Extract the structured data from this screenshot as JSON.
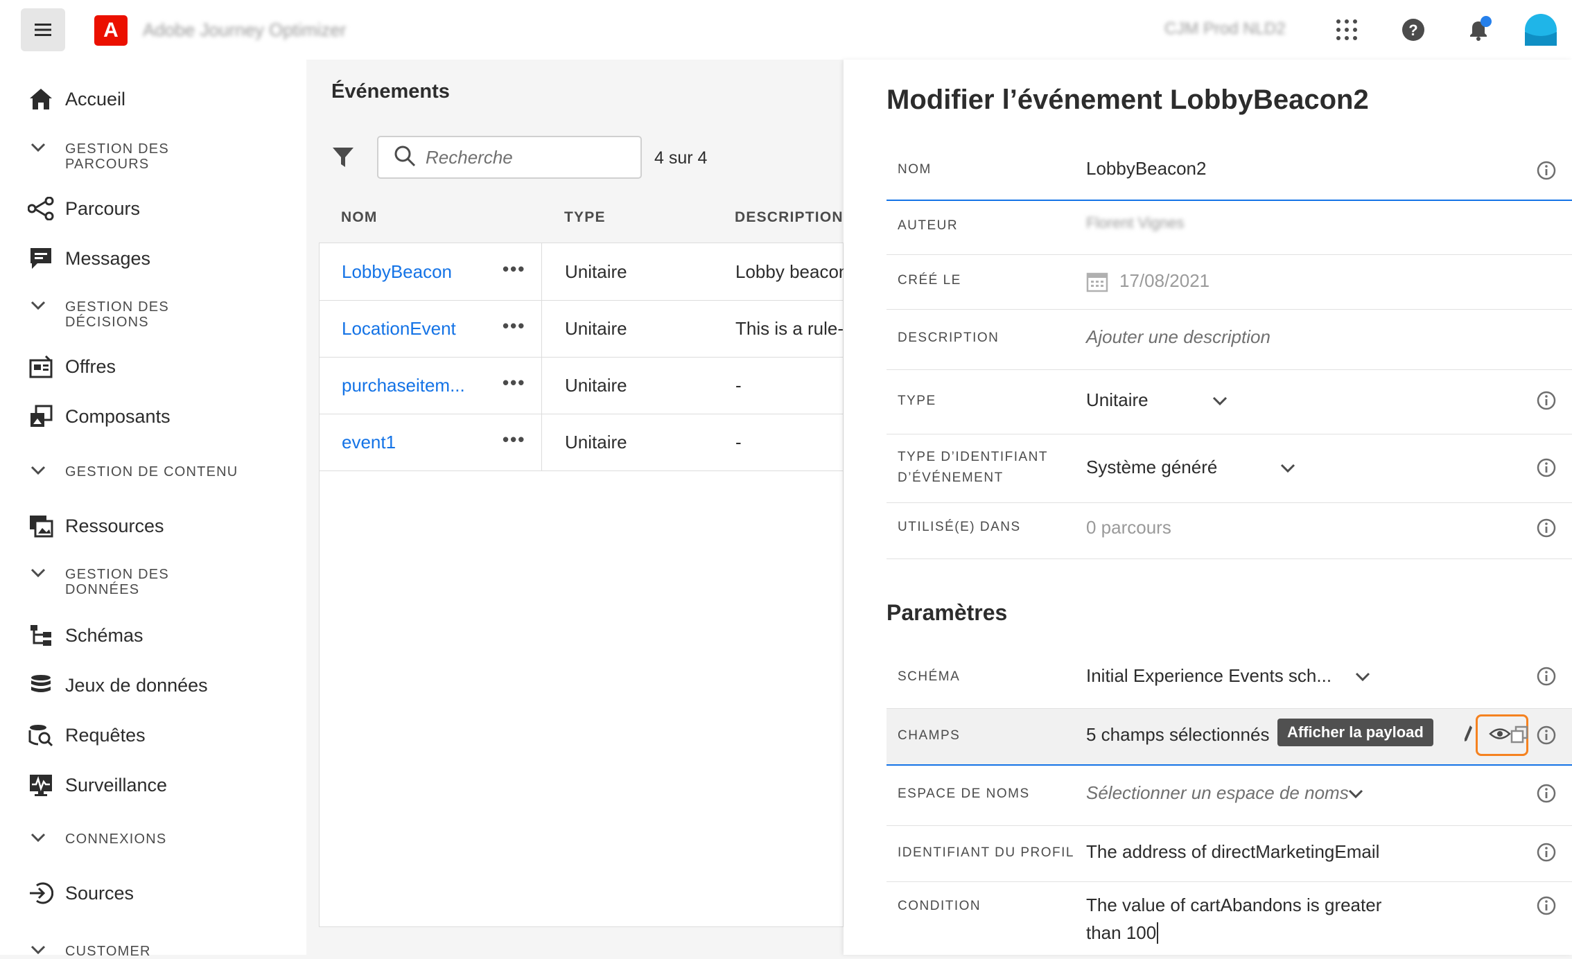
{
  "topbar": {
    "app_name": "Adobe Journey Optimizer",
    "org_name": "CJM Prod NLD2",
    "logo_letter": "A",
    "brand_color": "#eb1000",
    "accent_color": "#1473e6",
    "notification_color": "#2680eb"
  },
  "sidebar": {
    "home": "Accueil",
    "sections": [
      {
        "title": "GESTION DES PARCOURS",
        "items": [
          "Parcours",
          "Messages"
        ]
      },
      {
        "title": "GESTION DES DÉCISIONS",
        "items": [
          "Offres",
          "Composants"
        ]
      },
      {
        "title": "GESTION DE CONTENU",
        "items": [
          "Ressources"
        ]
      },
      {
        "title": "GESTION DES DONNÉES",
        "items": [
          "Schémas",
          "Jeux de données",
          "Requêtes",
          "Surveillance"
        ]
      },
      {
        "title": "CONNEXIONS",
        "items": [
          "Sources"
        ]
      },
      {
        "title": "CUSTOMER",
        "items": []
      }
    ]
  },
  "events": {
    "title": "Événements",
    "search_placeholder": "Recherche",
    "count": "4 sur 4",
    "columns": [
      "NOM",
      "TYPE",
      "DESCRIPTION"
    ],
    "rows": [
      {
        "name": "LobbyBeacon",
        "type": "Unitaire",
        "description": "Lobby beacon"
      },
      {
        "name": "LocationEvent",
        "type": "Unitaire",
        "description": "This is a rule-b"
      },
      {
        "name": "purchaseitem...",
        "type": "Unitaire",
        "description": "-"
      },
      {
        "name": "event1",
        "type": "Unitaire",
        "description": "-"
      }
    ],
    "more_glyph": "•••"
  },
  "editor": {
    "title": "Modifier l’événement LobbyBeacon2",
    "fields": {
      "nom": {
        "label": "NOM",
        "value": "LobbyBeacon2"
      },
      "auteur": {
        "label": "AUTEUR",
        "value": "Florent Vignes"
      },
      "cree": {
        "label": "CRÉÉ LE",
        "value": "17/08/2021"
      },
      "description": {
        "label": "DESCRIPTION",
        "value": "Ajouter une description"
      },
      "type": {
        "label": "TYPE",
        "value": "Unitaire"
      },
      "type_id": {
        "label1": "TYPE D’IDENTIFIANT",
        "label2": "D’ÉVÉNEMENT",
        "value": "Système généré"
      },
      "utilise": {
        "label": "UTILISÉ(E) DANS",
        "value": "0 parcours"
      }
    },
    "params_title": "Paramètres",
    "params": {
      "schema": {
        "label": "SCHÉMA",
        "value": "Initial Experience Events sch..."
      },
      "champs": {
        "label": "CHAMPS",
        "value": "5 champs sélectionnés",
        "tooltip": "Afficher la payload"
      },
      "espace": {
        "label": "ESPACE DE NOMS",
        "value": "Sélectionner un espace de noms"
      },
      "profil": {
        "label": "IDENTIFIANT DU PROFIL",
        "value": "The address of directMarketingEmail"
      },
      "condition": {
        "label": "CONDITION",
        "line1": "The value of cartAbandons is greater",
        "line2": "than 100"
      }
    },
    "highlight_color": "#f58220"
  }
}
